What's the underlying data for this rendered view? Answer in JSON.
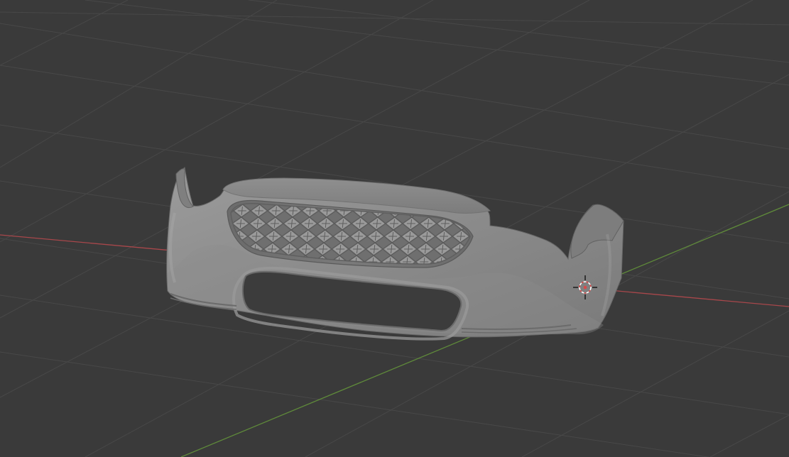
{
  "app": {
    "name": "3D Viewport"
  },
  "viewport": {
    "background_color": "#3a3a3a",
    "grid_color": "#4a4a4a",
    "x_axis_color": "#a8474b",
    "y_axis_color": "#5f8a3a",
    "model_color": "#8a8a8a",
    "model_shadow_color": "#5f5f5f",
    "model_highlight_color": "#a3a3a3",
    "grille_color": "#6f6f6f",
    "cursor_color": "#ffffff",
    "cursor_accent_color": "#d94a4a"
  },
  "objects": {
    "model": {
      "name": "front-bumper",
      "icon": "bumper-mesh"
    },
    "cursor": {
      "name": "3d-cursor",
      "icon": "crosshair-icon"
    }
  }
}
